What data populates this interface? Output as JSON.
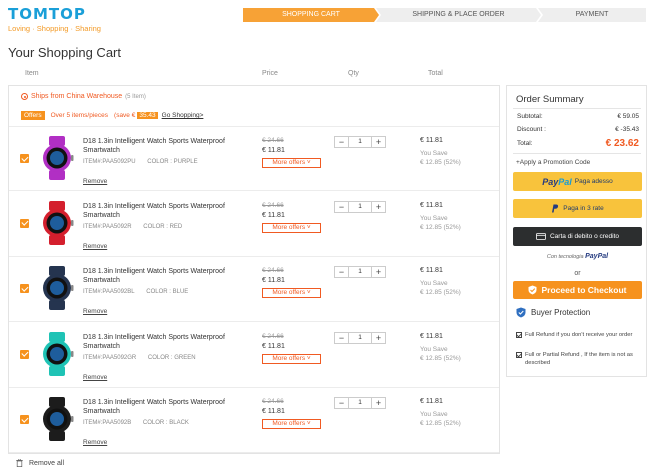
{
  "brand": {
    "name": "TOMTOP",
    "tagline": "Loving · Shopping · Sharing"
  },
  "steps": [
    "SHOPPING CART",
    "SHIPPING & PLACE ORDER",
    "PAYMENT"
  ],
  "page_title": "Your Shopping Cart",
  "columns": {
    "item": "Item",
    "price": "Price",
    "qty": "Qty",
    "total": "Total"
  },
  "warehouse": {
    "label": "Ships from China Warehouse",
    "count": "(5 Item)"
  },
  "offer": {
    "tag": "Offers",
    "desc": "Over 5 items/pieces",
    "save_label": "(save €",
    "save_amount": "35.43",
    "go_link": "Go Shopping>"
  },
  "items": [
    {
      "name": "D18 1.3in Intelligent Watch Sports Waterproof Smartwatch",
      "sku": "ITEM#:PAA5092PU",
      "color": "COLOR : PURPLE",
      "color_hex": "#b12fc4",
      "remove": "Remove",
      "old_price": "€ 24.66",
      "price": "€ 11.81",
      "more": "More offers ˅",
      "qty": "1",
      "total": "€ 11.81",
      "you_save": "You Save",
      "save": "€ 12.85 (52%)"
    },
    {
      "name": "D18 1.3in Intelligent Watch Sports Waterproof Smartwatch",
      "sku": "ITEM#:PAA5092R",
      "color": "COLOR : RED",
      "color_hex": "#d41f2d",
      "remove": "Remove",
      "old_price": "€ 24.66",
      "price": "€ 11.81",
      "more": "More offers ˅",
      "qty": "1",
      "total": "€ 11.81",
      "you_save": "You Save",
      "save": "€ 12.85 (52%)"
    },
    {
      "name": "D18 1.3in Intelligent Watch Sports Waterproof Smartwatch",
      "sku": "ITEM#:PAA5092BL",
      "color": "COLOR : BLUE",
      "color_hex": "#25344f",
      "remove": "Remove",
      "old_price": "€ 24.66",
      "price": "€ 11.81",
      "more": "More offers ˅",
      "qty": "1",
      "total": "€ 11.81",
      "you_save": "You Save",
      "save": "€ 12.85 (52%)"
    },
    {
      "name": "D18 1.3in Intelligent Watch Sports Waterproof Smartwatch",
      "sku": "ITEM#:PAA5092GR",
      "color": "COLOR : GREEN",
      "color_hex": "#1fc3b5",
      "remove": "Remove",
      "old_price": "€ 24.66",
      "price": "€ 11.81",
      "more": "More offers ˅",
      "qty": "1",
      "total": "€ 11.81",
      "you_save": "You Save",
      "save": "€ 12.85 (52%)"
    },
    {
      "name": "D18 1.3in Intelligent Watch Sports Waterproof Smartwatch",
      "sku": "ITEM#:PAA5092B",
      "color": "COLOR : BLACK",
      "color_hex": "#1c1c1c",
      "remove": "Remove",
      "old_price": "€ 24.66",
      "price": "€ 11.81",
      "more": "More offers ˅",
      "qty": "1",
      "total": "€ 11.81",
      "you_save": "You Save",
      "save": "€ 12.85 (52%)"
    }
  ],
  "qty_minus": "−",
  "qty_plus": "+",
  "remove_all": "Remove all",
  "summary": {
    "title": "Order Summary",
    "subtotal_label": "Subtotal:",
    "subtotal": "€ 59.05",
    "discount_label": "Discount :",
    "discount": "€ -35.43",
    "total_label": "Total:",
    "total": "€ 23.62",
    "promo": "+Apply a Promotion Code",
    "pp_paga_adesso": "Paga adesso",
    "pp_3_rate": "Paga in 3 rate",
    "pp_card": "Carta di debito o credito",
    "powered": "Con tecnologia",
    "or": "or",
    "checkout": "Proceed to Checkout",
    "buyer_protection": "Buyer Protection",
    "refund1": "Full Refund if you don't receive your order",
    "refund2": "Full or Partial Refund , If the item is not as described"
  },
  "paypal": {
    "p1": "Pay",
    "p2": "Pal"
  },
  "colors": {
    "accent": "#f6921e",
    "brand": "#1a9fd8",
    "link_red": "#f05a22",
    "paypal_yellow": "#f8c33c"
  }
}
